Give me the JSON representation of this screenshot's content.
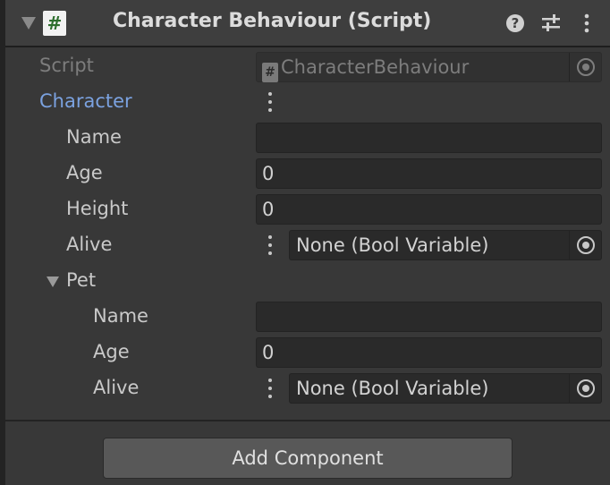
{
  "component": {
    "title": "Character Behaviour (Script)",
    "script_icon_glyph": "#",
    "header_icons": [
      "help-icon",
      "presets-icon",
      "more-menu-icon"
    ]
  },
  "script_field": {
    "label": "Script",
    "value": "CharacterBehaviour",
    "icon_glyph": "#"
  },
  "character": {
    "label": "Character",
    "name": {
      "label": "Name",
      "value": ""
    },
    "age": {
      "label": "Age",
      "value": "0"
    },
    "height": {
      "label": "Height",
      "value": "0"
    },
    "alive": {
      "label": "Alive",
      "value": "None (Bool Variable)"
    },
    "pet": {
      "label": "Pet",
      "name": {
        "label": "Name",
        "value": ""
      },
      "age": {
        "label": "Age",
        "value": "0"
      },
      "alive": {
        "label": "Alive",
        "value": "None (Bool Variable)"
      }
    }
  },
  "add_component_label": "Add Component",
  "colors": {
    "background": "#383838",
    "header": "#3e3e3e",
    "field": "#2a2a2a",
    "accent_label": "#7ba2e0",
    "button": "#585858"
  }
}
